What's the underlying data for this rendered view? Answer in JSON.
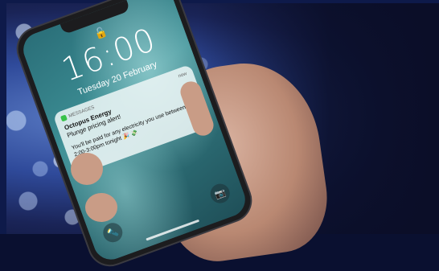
{
  "lockscreen": {
    "lock_icon": "lock-icon",
    "time": "16:00",
    "date": "Tuesday 20 February"
  },
  "notification": {
    "app_name": "MESSAGES",
    "time_ago": "now",
    "title": "Octopus Energy",
    "subtitle": "Plunge pricing alert!",
    "body": "You'll be paid for any electricity you use between 2:00-3:00pm tonight 🎉 💸"
  },
  "controls": {
    "torch_icon": "flashlight-icon",
    "camera_icon": "camera-icon"
  },
  "colors": {
    "background": "#0b0e28",
    "bokeh": "#5a7bc4",
    "wallpaper": "#3d8f95",
    "app_icon": "#38c24a"
  }
}
